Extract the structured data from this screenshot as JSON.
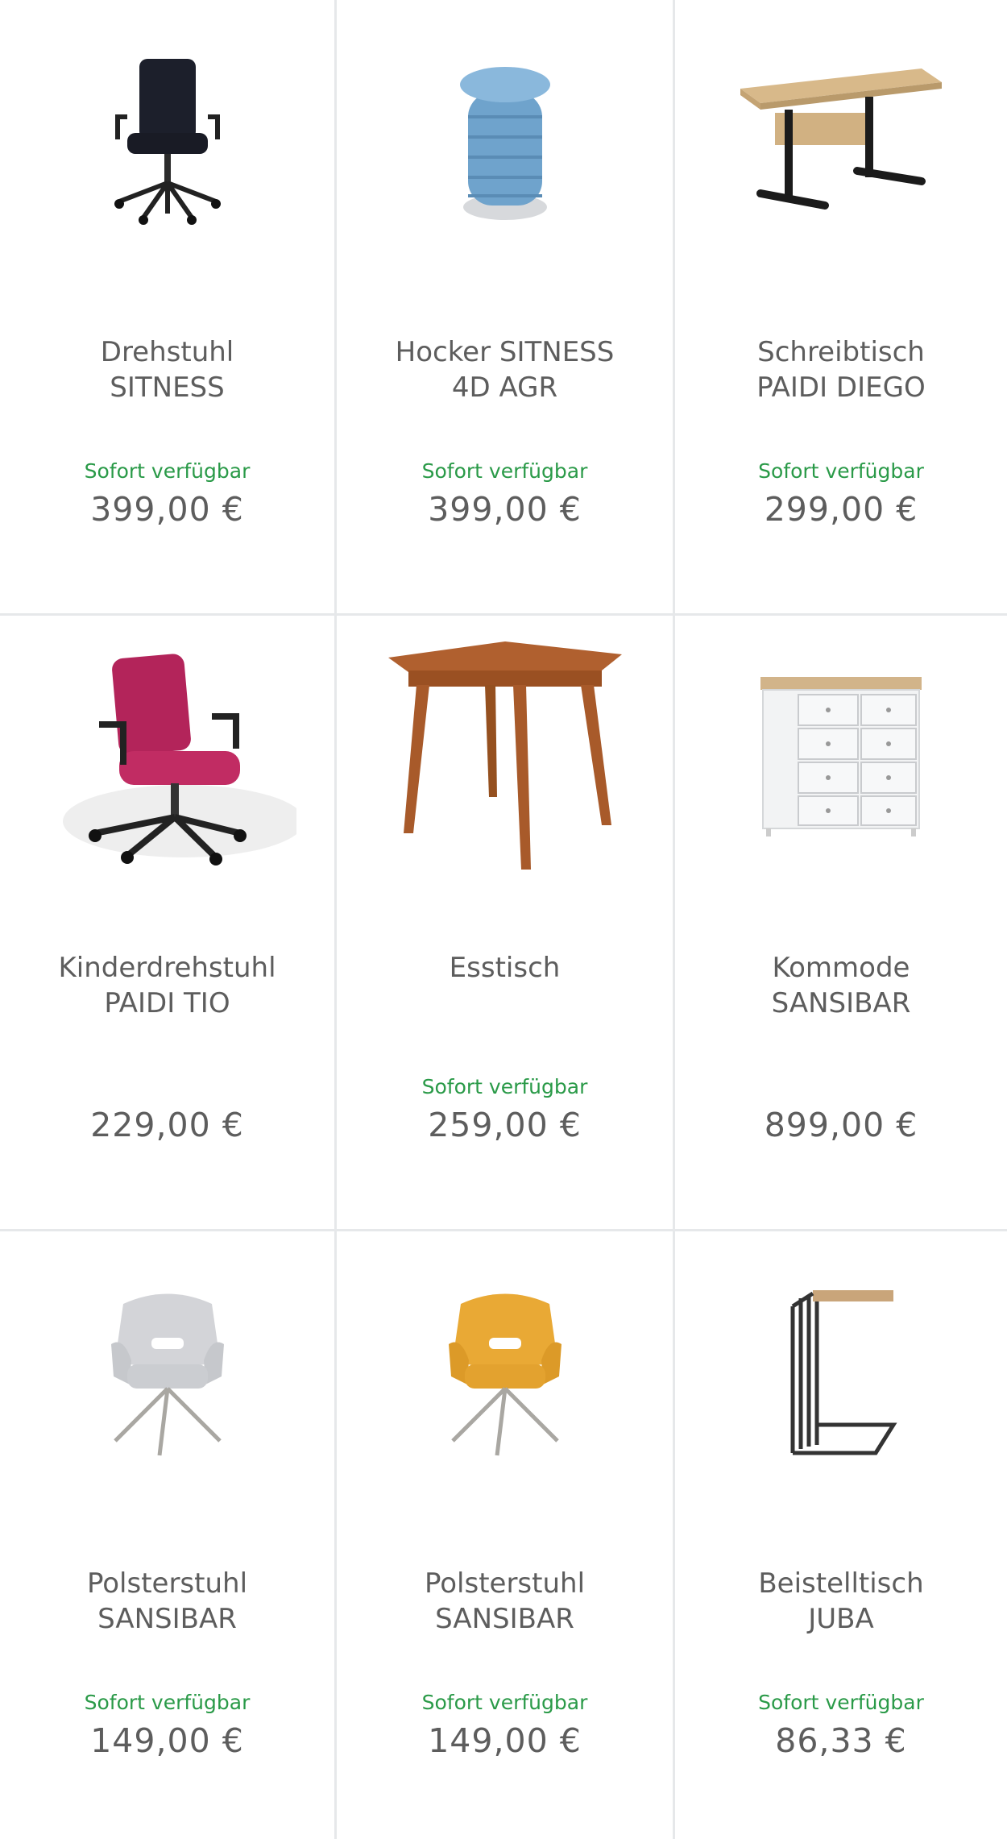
{
  "products": [
    {
      "title": "Drehstuhl\nSITNESS",
      "availability": "Sofort verfügbar",
      "price": "399,00 €",
      "icon": "office-chair-icon"
    },
    {
      "title": "Hocker SITNESS\n4D AGR",
      "availability": "Sofort verfügbar",
      "price": "399,00 €",
      "icon": "stool-icon"
    },
    {
      "title": "Schreibtisch\nPAIDI DIEGO",
      "availability": "Sofort verfügbar",
      "price": "299,00 €",
      "icon": "desk-icon"
    },
    {
      "title": "Kinderdrehstuhl\nPAIDI TIO",
      "availability": "",
      "price": "229,00 €",
      "icon": "kids-chair-icon"
    },
    {
      "title": "Esstisch",
      "availability": "Sofort verfügbar",
      "price": "259,00 €",
      "icon": "dining-table-icon"
    },
    {
      "title": "Kommode\nSANSIBAR",
      "availability": "",
      "price": "899,00 €",
      "icon": "dresser-icon"
    },
    {
      "title": "Polsterstuhl\nSANSIBAR",
      "availability": "Sofort verfügbar",
      "price": "149,00 €",
      "icon": "armchair-grey-icon"
    },
    {
      "title": "Polsterstuhl\nSANSIBAR",
      "availability": "Sofort verfügbar",
      "price": "149,00 €",
      "icon": "armchair-yellow-icon"
    },
    {
      "title": "Beistelltisch\nJUBA",
      "availability": "Sofort verfügbar",
      "price": "86,33 €",
      "icon": "side-table-icon"
    }
  ],
  "colors": {
    "availability": "#2a9a48",
    "text": "#5d5d5d",
    "divider": "#e6e8ea"
  }
}
